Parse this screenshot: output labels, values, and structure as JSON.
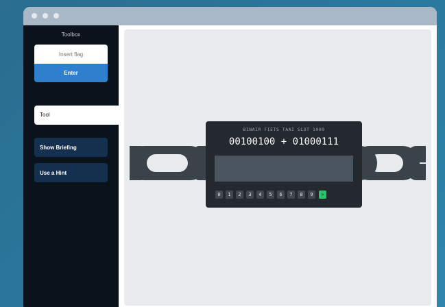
{
  "sidebar": {
    "title": "Toolbox",
    "flag_input_placeholder": "Insert flag",
    "enter_label": "Enter",
    "tool_tab_label": "Tool",
    "briefing_label": "Show Briefing",
    "hint_label": "Use a Hint"
  },
  "device": {
    "label": "BINAIR FIETS TAAI SLOT 1000",
    "equation": "00100100 + 01000111",
    "display_value": "",
    "keys": [
      "0",
      "1",
      "2",
      "3",
      "4",
      "5",
      "6",
      "7",
      "8",
      "9"
    ],
    "submit_key": ">"
  },
  "colors": {
    "background": "#2a7aa0",
    "sidebar": "#0a121c",
    "accent": "#2f7fcf",
    "submit": "#27c46b",
    "chain": "#3a424a"
  }
}
